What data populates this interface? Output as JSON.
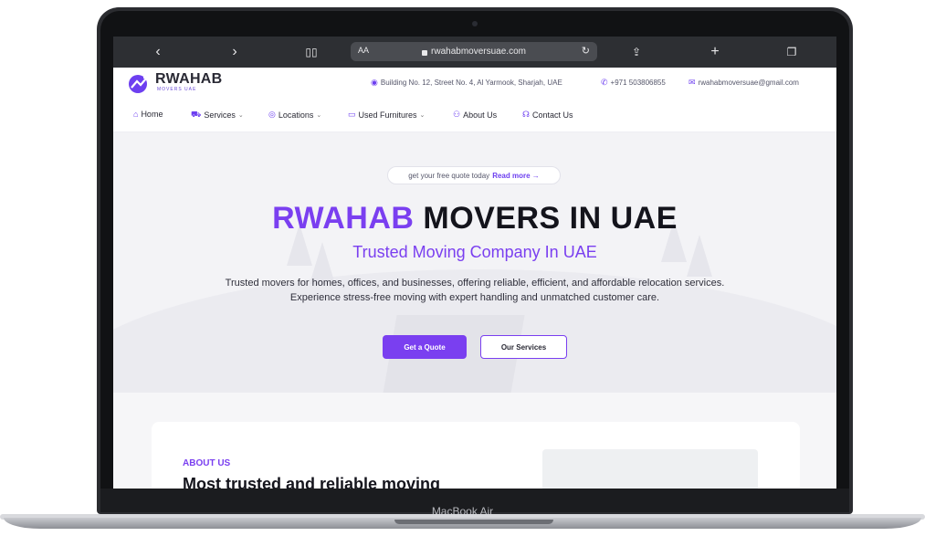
{
  "device": {
    "label": "MacBook Air"
  },
  "browser": {
    "url": "rwahabmoversuae.com",
    "text_size_label": "AA",
    "icons": [
      "back-icon",
      "forward-icon",
      "book-icon",
      "reload-icon",
      "share-icon",
      "new-tab-icon",
      "tabs-icon"
    ]
  },
  "header": {
    "brand": "RWAHAB",
    "brand_sub": "MOVERS UAE",
    "address": "Building No. 12, Street No. 4, Al Yarmook, Sharjah, UAE",
    "phone": "+971 503806855",
    "email": "rwahabmoversuae@gmail.com"
  },
  "nav": {
    "items": [
      {
        "label": "Home",
        "icon": "home-icon"
      },
      {
        "label": "Services",
        "icon": "truck-icon",
        "dropdown": true
      },
      {
        "label": "Locations",
        "icon": "pin-icon",
        "dropdown": true
      },
      {
        "label": "Used Furnitures",
        "icon": "sofa-icon",
        "dropdown": true
      },
      {
        "label": "About Us",
        "icon": "users-icon"
      },
      {
        "label": "Contact Us",
        "icon": "headset-icon"
      }
    ]
  },
  "hero": {
    "pill_text": "get your free quote today",
    "pill_link": "Read more →",
    "title_brand": "RWAHAB",
    "title_rest": " MOVERS IN UAE",
    "subtitle": "Trusted Moving Company In UAE",
    "description": "Trusted movers for homes, offices, and businesses, offering reliable, efficient, and affordable relocation services. Experience stress-free moving with expert handling and unmatched customer care.",
    "primary_button": "Get a Quote",
    "secondary_button": "Our Services"
  },
  "about": {
    "label": "ABOUT US",
    "title": "Most trusted and reliable moving"
  },
  "colors": {
    "accent": "#7a3ff0",
    "dark": "#14141c",
    "safari_bar": "#2d2f33"
  }
}
